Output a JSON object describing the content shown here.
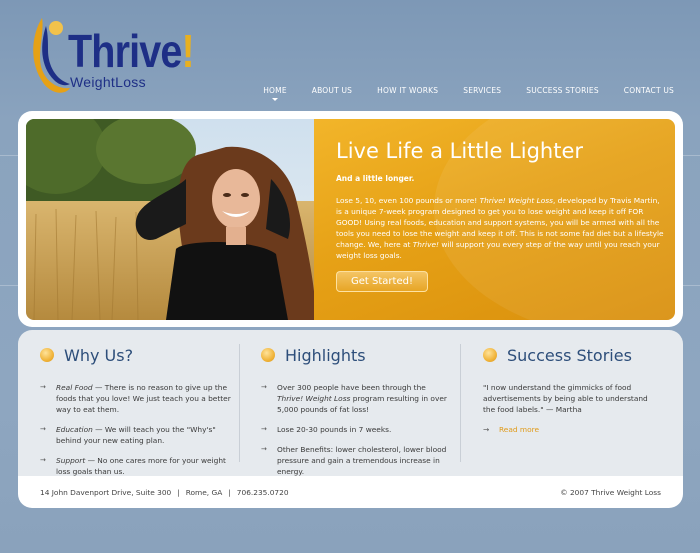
{
  "brand": {
    "name": "Thrive",
    "bang": "!",
    "subtitle": "WeightLoss",
    "navy": "#1e2f86",
    "gold": "#e8b020"
  },
  "nav": {
    "items": [
      {
        "label": "HOME"
      },
      {
        "label": "ABOUT US"
      },
      {
        "label": "HOW IT WORKS"
      },
      {
        "label": "SERVICES"
      },
      {
        "label": "SUCCESS STORIES"
      },
      {
        "label": "CONTACT US"
      }
    ],
    "active": "HOME"
  },
  "hero": {
    "title": "Live Life a Little Lighter",
    "subtitle": "And a little longer.",
    "body_1": "Lose 5, 10, even 100 pounds or more! ",
    "body_brand": "Thrive! Weight Loss",
    "body_2": ", developed by Travis Martin, is a unique 7-week program designed to get you to lose weight and keep it off FOR GOOD! Using real foods, education and support systems, you will be armed with all the tools you need to lose the weight and keep it off. This is not some fad diet but a lifestyle change. We, here at ",
    "body_brand2": "Thrive!",
    "body_3": " will support you every step of the way until you reach your weight loss goals.",
    "cta": "Get Started!",
    "photo_icon": "woman-in-wheat-field-photo"
  },
  "why": {
    "title": "Why Us?",
    "items": [
      {
        "lead": "Real Food",
        "text": " — There is no reason to give up the foods that you love! We just teach you a better way to eat them."
      },
      {
        "lead": "Education",
        "text": " — We will teach you the \"Why's\" behind your new eating plan."
      },
      {
        "lead": "Support",
        "text": " — No one cares more for your weight loss goals than us."
      }
    ]
  },
  "highlights": {
    "title": "Highlights",
    "item1_a": "Over 300 people have been through the ",
    "item1_brand": "Thrive! Weight Loss",
    "item1_b": " program resulting in over 5,000 pounds of fat loss!",
    "item2": "Lose 20-30 pounds in 7 weeks.",
    "item3": "Other Benefits: lower cholesterol, lower blood pressure and gain a tremendous increase in energy."
  },
  "stories": {
    "title": "Success Stories",
    "quote": "\"I now understand the gimmicks of food advertisements by being able to understand the food labels.\" — Martha",
    "read_more": "Read more"
  },
  "footer": {
    "address": "14 John Davenport Drive, Suite 300",
    "sep": "|",
    "city": "Rome, GA",
    "phone": "706.235.0720",
    "copyright": "© 2007 Thrive Weight Loss"
  },
  "colors": {
    "accent": "#e6a116",
    "heading": "#2d4e7a",
    "background": "#8aa3be"
  }
}
